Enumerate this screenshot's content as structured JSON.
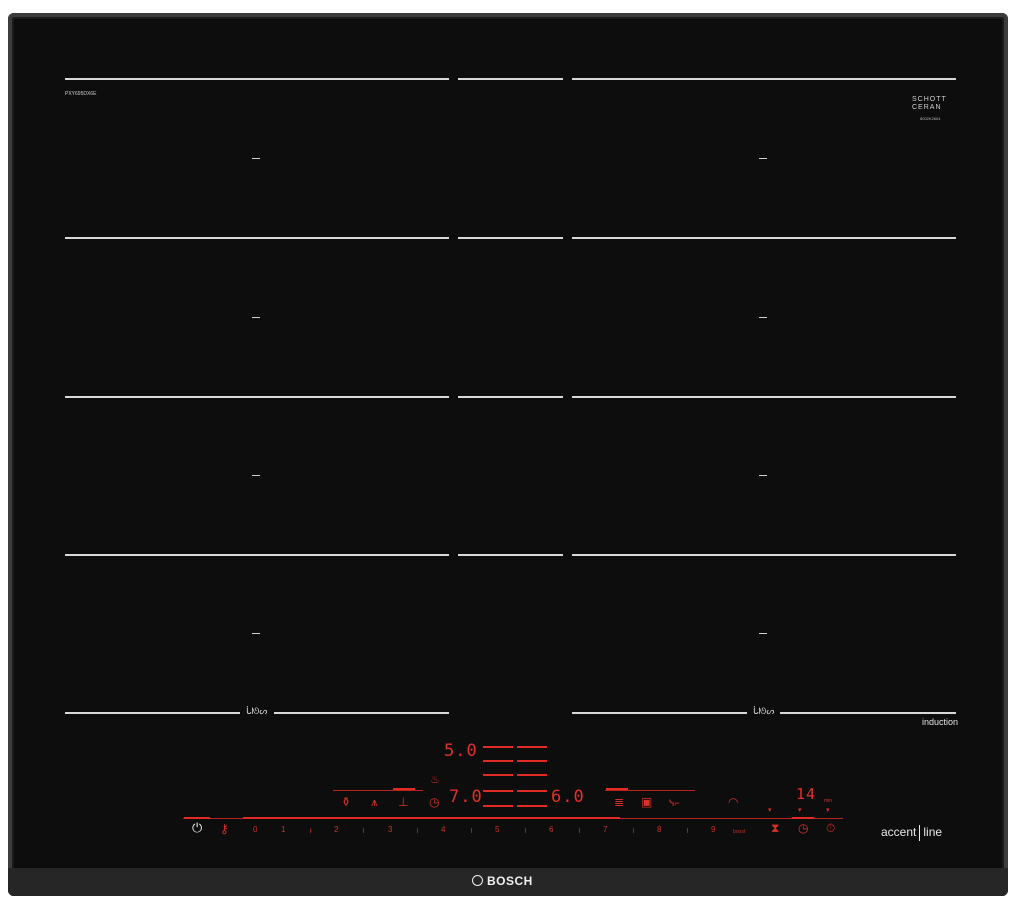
{
  "brand": {
    "name": "BOSCH"
  },
  "model_code": "PXY695DX6E",
  "glass": {
    "line1": "SCHOTT",
    "line2": "CERAN",
    "small_code": "8002K2604"
  },
  "induction_label": "induction",
  "series": {
    "left": "accent",
    "right": "line"
  },
  "flex_symbol": "ᒑᘚᔕ",
  "displays": {
    "front_top": "5.0",
    "front_left": "7.0",
    "front_right": "6.0",
    "timer": "14",
    "timer_unit": "min"
  },
  "slider_numbers": [
    "0",
    "1",
    "2",
    "3",
    "4",
    "5",
    "6",
    "7",
    "8",
    "9"
  ],
  "boost_label": "boost",
  "icons": {
    "power": "power-icon",
    "child_lock": "child-lock-icon",
    "frying": "frying-sensor-icon",
    "keep_warm": "keep-warm-icon",
    "pan": "pan-icon",
    "pot": "pot-icon",
    "clock": "clock-icon",
    "wifi": "wifi-icon",
    "hourglass": "hourglass-icon",
    "timer": "timer-icon",
    "stopwatch": "stopwatch-icon",
    "power_move": "power-move-icon",
    "move": "move-icon",
    "flex": "flex-zone-icon"
  },
  "colors": {
    "accent_red": "#e0302a",
    "glass": "#0d0d0d",
    "frame": "#3c3c3c"
  }
}
